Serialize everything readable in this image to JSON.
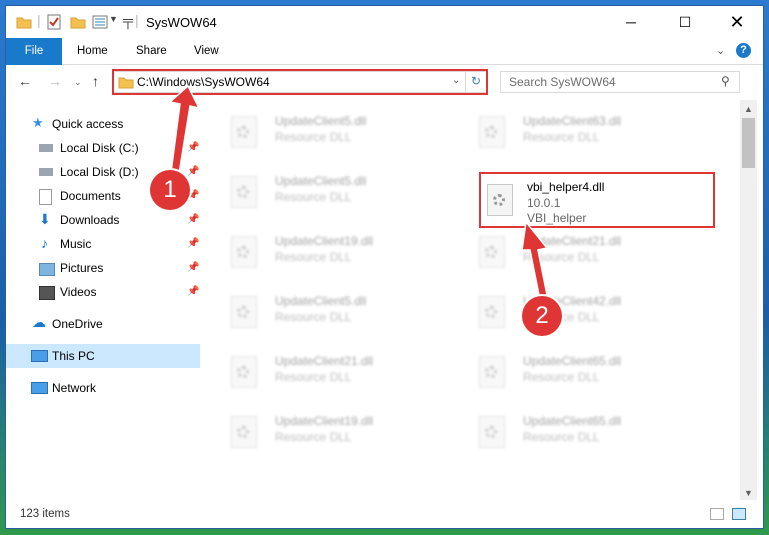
{
  "window": {
    "title": "SysWOW64",
    "controls": [
      "minimize-icon",
      "maximize-icon",
      "close-icon"
    ]
  },
  "ribbon": {
    "tabs": [
      "File",
      "Home",
      "Share",
      "View"
    ],
    "help": "?"
  },
  "nav": {
    "address": "C:\\Windows\\SysWOW64",
    "search_placeholder": "Search SysWOW64"
  },
  "sidebar": {
    "items": [
      {
        "label": "Quick access",
        "icon": "star-icon",
        "pinned": false
      },
      {
        "label": "Local Disk (C:)",
        "icon": "drive-icon",
        "pinned": true
      },
      {
        "label": "Local Disk (D:)",
        "icon": "drive-icon",
        "pinned": true
      },
      {
        "label": "Documents",
        "icon": "documents-icon",
        "pinned": true
      },
      {
        "label": "Downloads",
        "icon": "download-icon",
        "pinned": true
      },
      {
        "label": "Music",
        "icon": "music-icon",
        "pinned": true
      },
      {
        "label": "Pictures",
        "icon": "pictures-icon",
        "pinned": true
      },
      {
        "label": "Videos",
        "icon": "videos-icon",
        "pinned": true
      },
      {
        "label": "OneDrive",
        "icon": "cloud-icon",
        "pinned": false
      },
      {
        "label": "This PC",
        "icon": "computer-icon",
        "pinned": false,
        "selected": true
      },
      {
        "label": "Network",
        "icon": "network-icon",
        "pinned": false
      }
    ]
  },
  "files": {
    "left": [
      {
        "name": "UpdateClient5.dll",
        "desc": "Resource DLL"
      },
      {
        "name": "UpdateClient5.dll",
        "desc": "Resource DLL"
      },
      {
        "name": "UpdateClient19.dll",
        "desc": "Resource DLL"
      },
      {
        "name": "UpdateClient5.dll",
        "desc": "Resource DLL"
      },
      {
        "name": "UpdateClient21.dll",
        "desc": "Resource DLL"
      },
      {
        "name": "UpdateClient19.dll",
        "desc": "Resource DLL"
      }
    ],
    "right": [
      {
        "name": "UpdateClient63.dll",
        "desc": "Resource DLL"
      },
      {
        "name": "UpdateClient21.dll",
        "desc": "Resource DLL"
      },
      {
        "name": "UpdateClient42.dll",
        "desc": "Resource DLL"
      },
      {
        "name": "UpdateClient65.dll",
        "desc": "Resource DLL"
      },
      {
        "name": "UpdateClient65.dll",
        "desc": "Resource DLL"
      }
    ],
    "highlighted": {
      "name": "vbi_helper4.dll",
      "version": "10.0.1",
      "desc": "VBI_helper"
    }
  },
  "status": {
    "item_count": "123 items"
  },
  "annotations": {
    "step1": "1",
    "step2": "2",
    "color": "#e03535"
  }
}
